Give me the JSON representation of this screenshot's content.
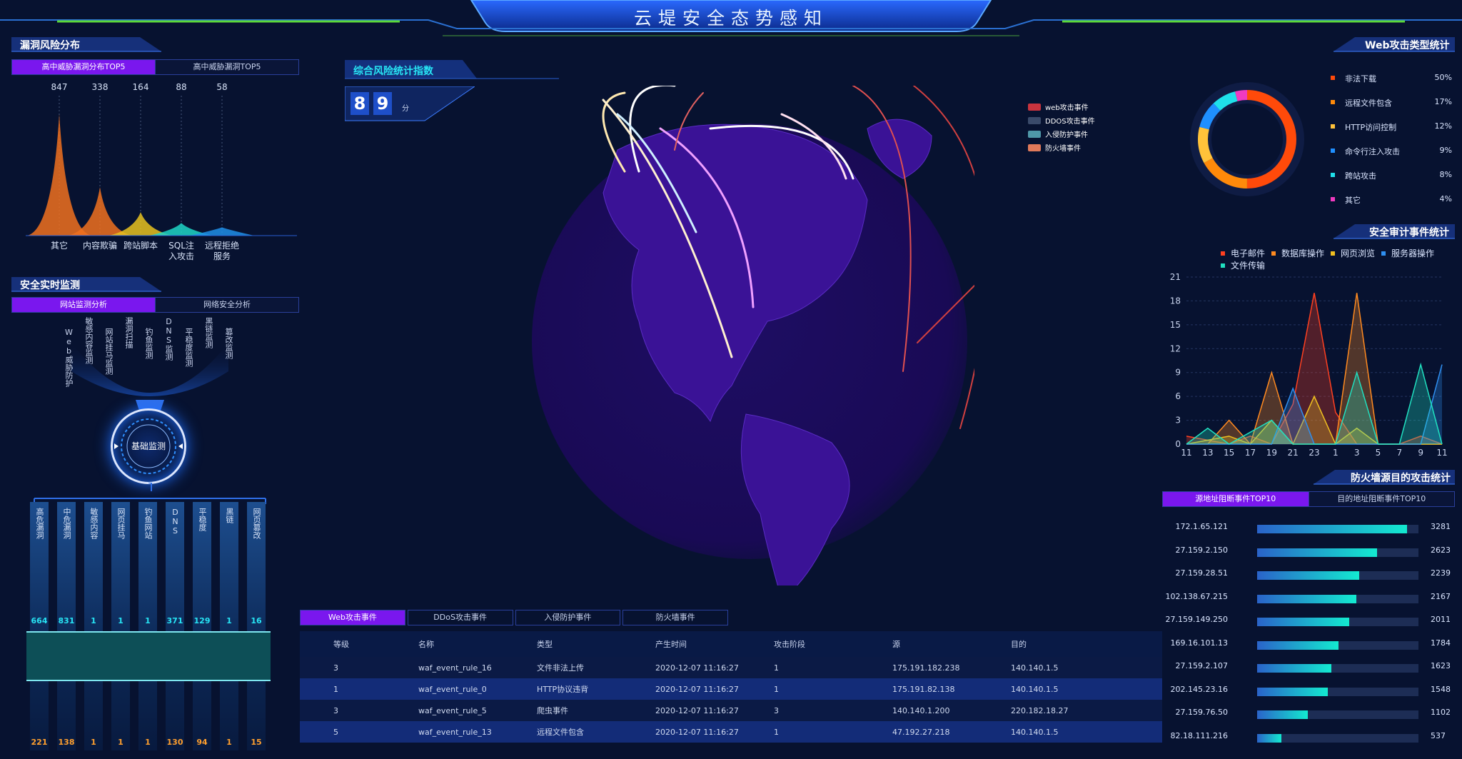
{
  "header": {
    "title": "云堤安全态势感知"
  },
  "colors": {
    "accent": "#7a17ee",
    "background": "#071230",
    "cyan": "#27e4f4",
    "orange": "#ff9f2e"
  },
  "vuln": {
    "title": "漏洞风险分布",
    "tabs": [
      {
        "label": "高中威胁漏洞分布TOP5"
      },
      {
        "label": "高中威胁漏洞TOP5"
      }
    ],
    "chart_data": {
      "type": "area",
      "categories": [
        "其它",
        "内容欺骗",
        "跨站脚本",
        "SQL注入攻击",
        "远程拒绝服务"
      ],
      "values": [
        847,
        338,
        164,
        88,
        58
      ],
      "colors": [
        "#f0711f",
        "#f0711f",
        "#e8c21e",
        "#1fd6c6",
        "#1f8fe8"
      ]
    },
    "labels_line2": [
      "",
      "",
      "",
      "入攻击",
      "服务"
    ],
    "labels_line1": [
      "其它",
      "内容欺骗",
      "跨站脚本",
      "SQL注",
      "远程拒绝"
    ]
  },
  "monitor": {
    "title": "安全实时监测",
    "tabs": [
      {
        "label": "网站监测分析"
      },
      {
        "label": "网络安全分析"
      }
    ],
    "fan_items": [
      "Web威胁防护",
      "敏感内容监测",
      "网站挂马监测",
      "漏洞扫描",
      "钓鱼监测",
      "DNS监测",
      "平稳度监测",
      "黑链监测",
      "篡改监测"
    ],
    "center_label": "基础监测"
  },
  "bars": {
    "labels": [
      "高危漏洞",
      "中危漏洞",
      "敏感内容",
      "网页挂马",
      "钓鱼网站",
      "DNS",
      "平稳度",
      "黑链",
      "网页篡改"
    ],
    "top_values": [
      664,
      831,
      1,
      1,
      1,
      371,
      129,
      1,
      16
    ],
    "bottom_values": [
      221,
      138,
      1,
      1,
      1,
      130,
      94,
      1,
      15
    ]
  },
  "score": {
    "title": "综合风险统计指数",
    "digits": [
      "8",
      "9"
    ],
    "unit": "分"
  },
  "globe": {
    "legend": [
      {
        "label": "web攻击事件",
        "color": "#c9343e"
      },
      {
        "label": "DDOS攻击事件",
        "color": "#3a4a6a"
      },
      {
        "label": "入侵防护事件",
        "color": "#4f98a8"
      },
      {
        "label": "防火墙事件",
        "color": "#e07a5a"
      }
    ]
  },
  "events": {
    "tabs": [
      {
        "label": "Web攻击事件"
      },
      {
        "label": "DDoS攻击事件"
      },
      {
        "label": "入侵防护事件"
      },
      {
        "label": "防火墙事件"
      }
    ],
    "columns": [
      "等级",
      "名称",
      "类型",
      "产生时间",
      "攻击阶段",
      "源",
      "目的"
    ],
    "rows": [
      [
        "3",
        "waf_event_rule_16",
        "文件非法上传",
        "2020-12-07 11:16:27",
        "1",
        "175.191.182.238",
        "140.140.1.5"
      ],
      [
        "1",
        "waf_event_rule_0",
        "HTTP协议违背",
        "2020-12-07 11:16:27",
        "1",
        "175.191.82.138",
        "140.140.1.5"
      ],
      [
        "3",
        "waf_event_rule_5",
        "爬虫事件",
        "2020-12-07 11:16:27",
        "3",
        "140.140.1.200",
        "220.182.18.27"
      ],
      [
        "5",
        "waf_event_rule_13",
        "远程文件包含",
        "2020-12-07 11:16:27",
        "1",
        "47.192.27.218",
        "140.140.1.5"
      ]
    ]
  },
  "web_attack": {
    "title": "Web攻击类型统计",
    "chart_data": {
      "type": "pie",
      "items": [
        {
          "name": "非法下载",
          "value": "50%",
          "pct": 50,
          "color": "#ff4a0a"
        },
        {
          "name": "远程文件包含",
          "value": "17%",
          "pct": 17,
          "color": "#ff8a0a"
        },
        {
          "name": "HTTP访问控制",
          "value": "12%",
          "pct": 12,
          "color": "#ffc23a"
        },
        {
          "name": "命令行注入攻击",
          "value": "9%",
          "pct": 9,
          "color": "#1f8fff"
        },
        {
          "name": "跨站攻击",
          "value": "8%",
          "pct": 8,
          "color": "#1fe0ea"
        },
        {
          "name": "其它",
          "value": "4%",
          "pct": 4,
          "color": "#f03ac0"
        }
      ]
    }
  },
  "audit": {
    "title": "安全审计事件统计",
    "chart_data": {
      "type": "area",
      "x": [
        "11",
        "13",
        "15",
        "17",
        "19",
        "21",
        "23",
        "1",
        "3",
        "5",
        "7",
        "9",
        "11"
      ],
      "yticks": [
        "0",
        "3",
        "6",
        "9",
        "12",
        "15",
        "18",
        "21"
      ],
      "ylim": [
        0,
        21
      ],
      "series": [
        {
          "name": "电子邮件",
          "color": "#ff4020",
          "points": [
            [
              0,
              1
            ],
            [
              2,
              0
            ],
            [
              3,
              1
            ],
            [
              4,
              0
            ],
            [
              5,
              5
            ],
            [
              6,
              19
            ],
            [
              7,
              4
            ],
            [
              8,
              0
            ],
            [
              10,
              0
            ],
            [
              11,
              1
            ],
            [
              12,
              0
            ]
          ]
        },
        {
          "name": "数据库操作",
          "color": "#ff8a20",
          "points": [
            [
              0,
              0
            ],
            [
              1,
              0
            ],
            [
              2,
              3
            ],
            [
              3,
              0
            ],
            [
              4,
              9
            ],
            [
              5,
              0
            ],
            [
              7,
              0
            ],
            [
              8,
              19
            ],
            [
              9,
              0
            ],
            [
              12,
              0
            ]
          ]
        },
        {
          "name": "网页浏览",
          "color": "#f0c020",
          "points": [
            [
              0,
              0
            ],
            [
              2,
              1
            ],
            [
              3,
              0
            ],
            [
              4,
              3
            ],
            [
              5,
              0
            ],
            [
              6,
              6
            ],
            [
              7,
              0
            ],
            [
              8,
              2
            ],
            [
              9,
              0
            ],
            [
              12,
              0
            ]
          ]
        },
        {
          "name": "服务器操作",
          "color": "#2f8ff0",
          "points": [
            [
              0,
              0
            ],
            [
              4,
              0
            ],
            [
              5,
              7
            ],
            [
              6,
              0
            ],
            [
              7,
              0
            ],
            [
              10,
              0
            ],
            [
              11,
              0
            ],
            [
              12,
              10
            ]
          ]
        },
        {
          "name": "文件传输",
          "color": "#20e0c0",
          "points": [
            [
              0,
              0
            ],
            [
              1,
              2
            ],
            [
              2,
              0
            ],
            [
              4,
              3
            ],
            [
              5,
              0
            ],
            [
              7,
              0
            ],
            [
              8,
              9
            ],
            [
              9,
              0
            ],
            [
              10,
              0
            ],
            [
              11,
              10
            ],
            [
              12,
              0
            ]
          ]
        }
      ]
    }
  },
  "firewall": {
    "title": "防火墙源目的攻击统计",
    "tabs": [
      {
        "label": "源地址阻断事件TOP10"
      },
      {
        "label": "目的地址阻断事件TOP10"
      }
    ],
    "max": 3281,
    "rows": [
      {
        "ip": "172.1.65.121",
        "value": 3281
      },
      {
        "ip": "27.159.2.150",
        "value": 2623
      },
      {
        "ip": "27.159.28.51",
        "value": 2239
      },
      {
        "ip": "102.138.67.215",
        "value": 2167
      },
      {
        "ip": "27.159.149.250",
        "value": 2011
      },
      {
        "ip": "169.16.101.13",
        "value": 1784
      },
      {
        "ip": "27.159.2.107",
        "value": 1623
      },
      {
        "ip": "202.145.23.16",
        "value": 1548
      },
      {
        "ip": "27.159.76.50",
        "value": 1102
      },
      {
        "ip": "82.18.111.216",
        "value": 537
      }
    ]
  }
}
